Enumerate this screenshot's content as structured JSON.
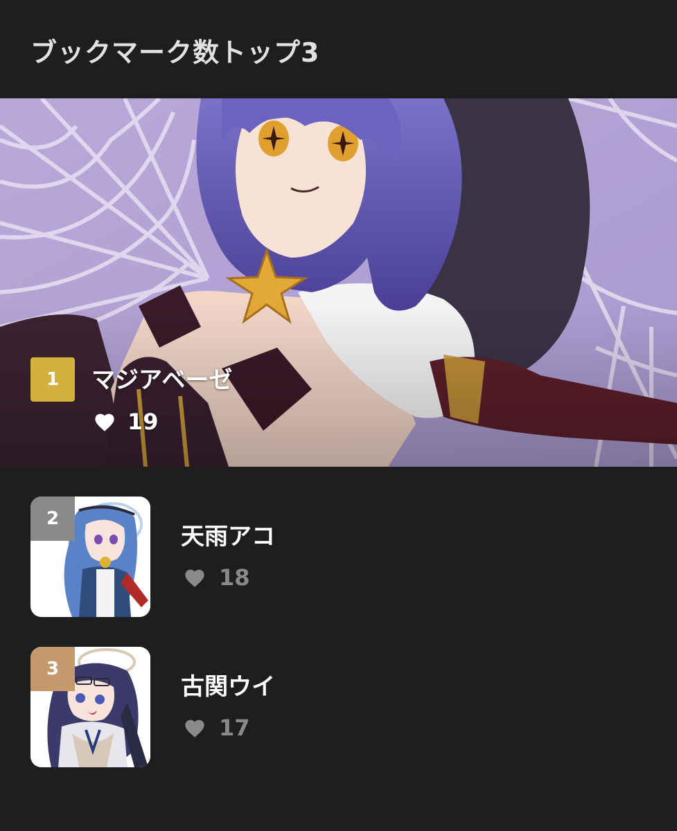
{
  "page": {
    "title": "ブックマーク数トップ3"
  },
  "colors": {
    "background": "#1e1e1e",
    "rank_1": "#d4b03c",
    "rank_2": "#8a8a8a",
    "rank_3": "#c49a6c",
    "like_count_muted": "#8a8a8a"
  },
  "ranking": [
    {
      "rank": "1",
      "name": "マジアベーゼ",
      "likes": "19",
      "icon": "heart-icon"
    },
    {
      "rank": "2",
      "name": "天雨アコ",
      "likes": "18",
      "icon": "heart-icon"
    },
    {
      "rank": "3",
      "name": "古関ウイ",
      "likes": "17",
      "icon": "heart-icon"
    }
  ]
}
